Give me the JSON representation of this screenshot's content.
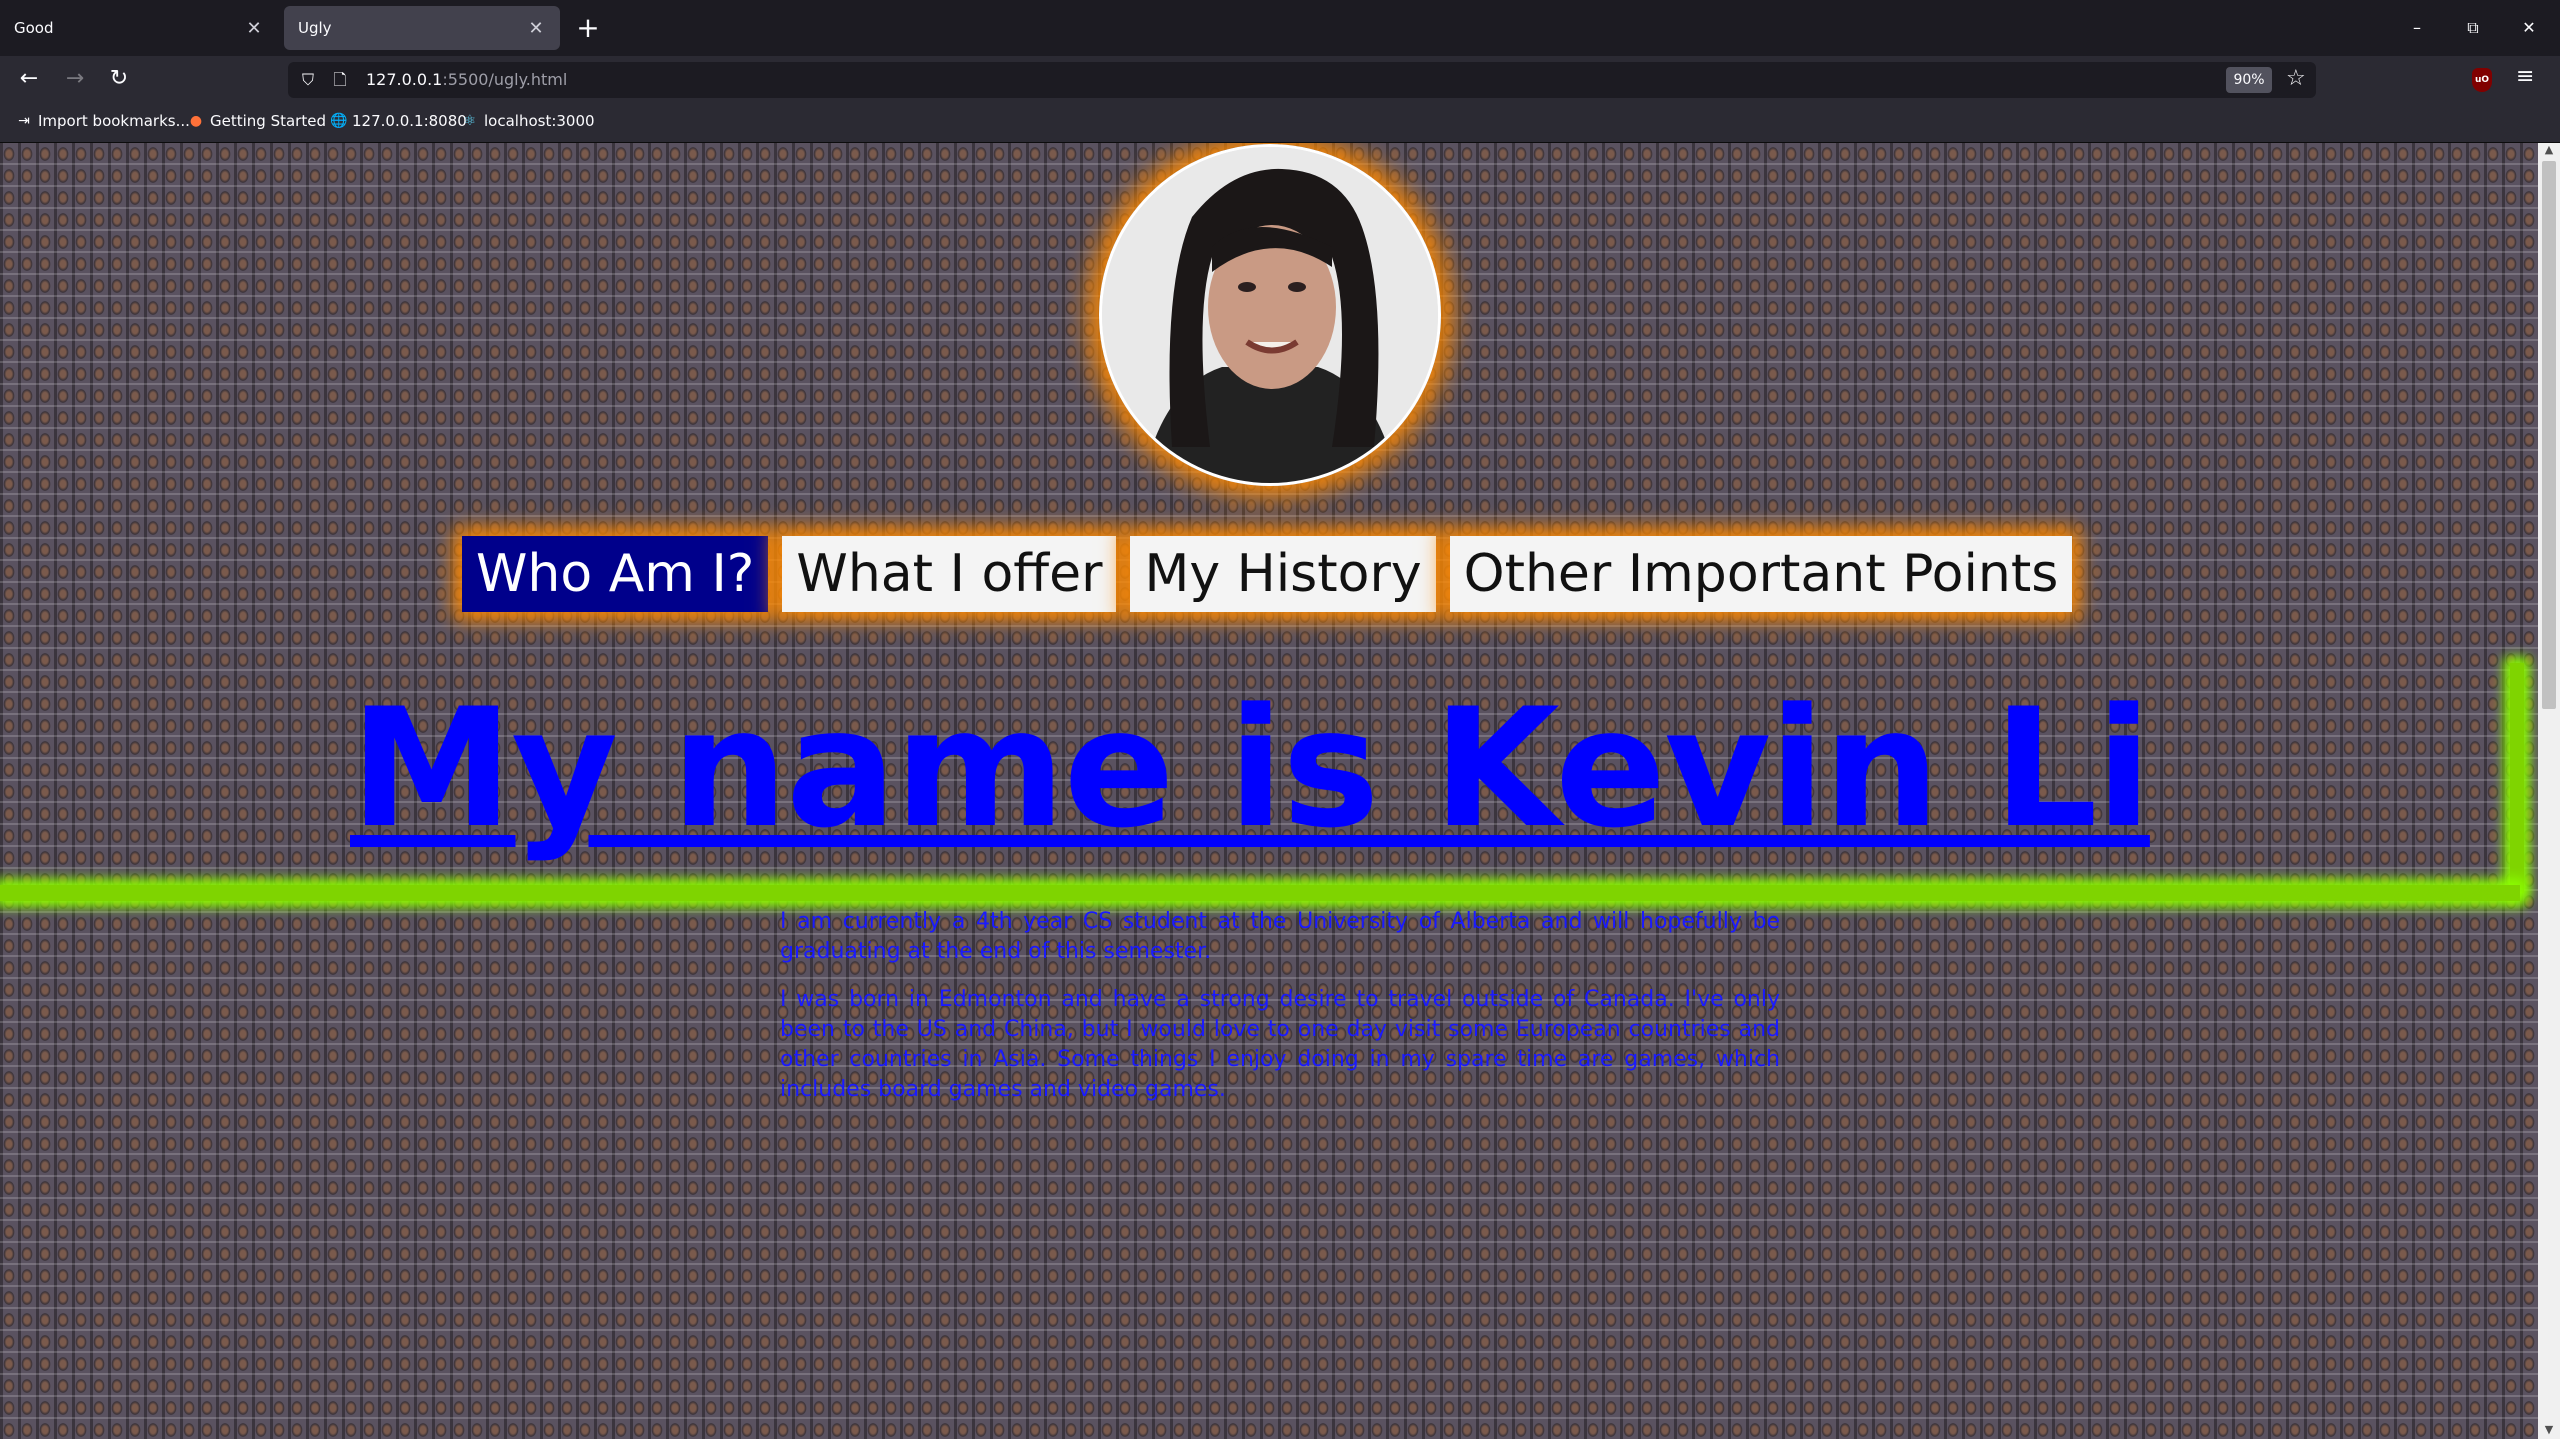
{
  "browser": {
    "tabs": [
      {
        "title": "Good",
        "active": false
      },
      {
        "title": "Ugly",
        "active": true
      }
    ],
    "url": {
      "host": "127.0.0.1",
      "path": ":5500/ugly.html"
    },
    "zoom": "90%",
    "bookmarks": [
      {
        "label": "Import bookmarks...",
        "icon": "import-icon"
      },
      {
        "label": "Getting Started",
        "icon": "firefox-icon"
      },
      {
        "label": "127.0.0.1:8080",
        "icon": "globe-icon"
      },
      {
        "label": "localhost:3000",
        "icon": "react-icon"
      }
    ]
  },
  "page": {
    "nav": [
      {
        "label": "Who Am I?",
        "active": true
      },
      {
        "label": "What I offer",
        "active": false
      },
      {
        "label": "My History",
        "active": false
      },
      {
        "label": "Other Important Points",
        "active": false
      }
    ],
    "heading": "My name is Kevin Li",
    "paragraphs": [
      "I am currently a 4th year CS student at the University of Alberta and will hopefully be graduating at the end of this semester.",
      "I was born in Edmonton and have a strong desire to travel outside of Canada. I've only been to the US and China, but I would love to one day visit some European countries and other countries in Asia. Some things I enjoy doing in my spare time are games, which includes board games and video games."
    ],
    "colors": {
      "glow": "#ff8a00",
      "heading": "#0000ff",
      "nav_active_bg": "#00008b",
      "green_bar": "#7fd400"
    }
  }
}
